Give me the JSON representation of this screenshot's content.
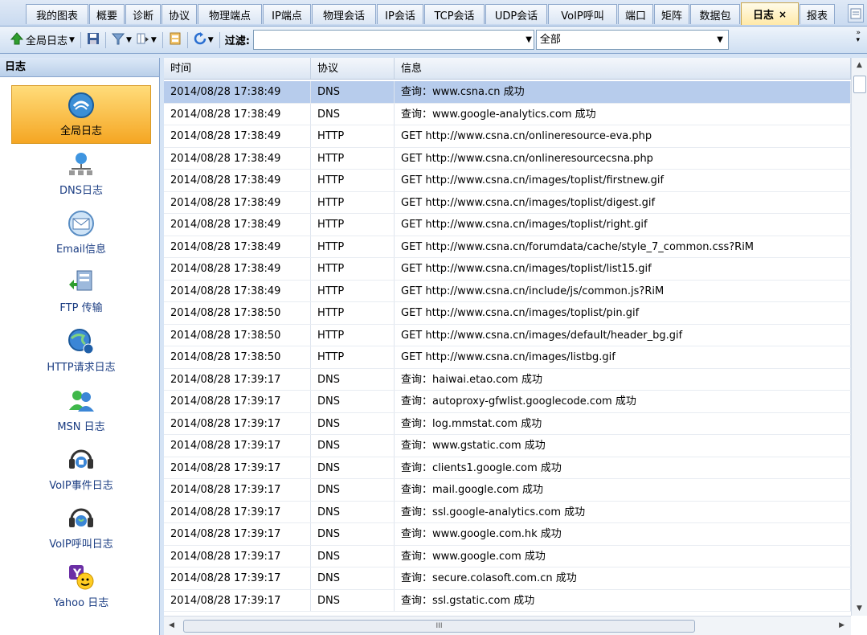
{
  "tabs": [
    {
      "label": "我的图表"
    },
    {
      "label": "概要"
    },
    {
      "label": "诊断"
    },
    {
      "label": "协议"
    },
    {
      "label": "物理端点"
    },
    {
      "label": "IP端点"
    },
    {
      "label": "物理会话"
    },
    {
      "label": "IP会话"
    },
    {
      "label": "TCP会话"
    },
    {
      "label": "UDP会话"
    },
    {
      "label": "VoIP呼叫"
    },
    {
      "label": "端口"
    },
    {
      "label": "矩阵"
    },
    {
      "label": "数据包"
    },
    {
      "label": "日志",
      "close": "×"
    },
    {
      "label": "报表"
    }
  ],
  "toolbar": {
    "global_log": "全局日志",
    "filter_label": "过滤:",
    "filter_value": "",
    "scope_value": "全部"
  },
  "sidebar": {
    "title": "日志",
    "items": [
      {
        "label": "全局日志",
        "icon": "global-log-icon"
      },
      {
        "label": "DNS日志",
        "icon": "dns-network-icon"
      },
      {
        "label": "Email信息",
        "icon": "email-icon"
      },
      {
        "label": "FTP 传输",
        "icon": "ftp-transfer-icon"
      },
      {
        "label": "HTTP请求日志",
        "icon": "http-globe-icon"
      },
      {
        "label": "MSN 日志",
        "icon": "msn-users-icon"
      },
      {
        "label": "VoIP事件日志",
        "icon": "voip-event-headset-icon"
      },
      {
        "label": "VoIP呼叫日志",
        "icon": "voip-call-headset-icon"
      },
      {
        "label": "Yahoo 日志",
        "icon": "yahoo-messenger-icon"
      }
    ]
  },
  "grid": {
    "headers": [
      "时间",
      "协议",
      "信息"
    ],
    "rows": [
      [
        "2014/08/28 17:38:49",
        "DNS",
        "查询：www.csna.cn 成功"
      ],
      [
        "2014/08/28 17:38:49",
        "DNS",
        "查询：www.google-analytics.com 成功"
      ],
      [
        "2014/08/28 17:38:49",
        "HTTP",
        "GET http://www.csna.cn/onlineresource-eva.php"
      ],
      [
        "2014/08/28 17:38:49",
        "HTTP",
        "GET http://www.csna.cn/onlineresourcecsna.php"
      ],
      [
        "2014/08/28 17:38:49",
        "HTTP",
        "GET http://www.csna.cn/images/toplist/firstnew.gif"
      ],
      [
        "2014/08/28 17:38:49",
        "HTTP",
        "GET http://www.csna.cn/images/toplist/digest.gif"
      ],
      [
        "2014/08/28 17:38:49",
        "HTTP",
        "GET http://www.csna.cn/images/toplist/right.gif"
      ],
      [
        "2014/08/28 17:38:49",
        "HTTP",
        "GET http://www.csna.cn/forumdata/cache/style_7_common.css?RiM"
      ],
      [
        "2014/08/28 17:38:49",
        "HTTP",
        "GET http://www.csna.cn/images/toplist/list15.gif"
      ],
      [
        "2014/08/28 17:38:49",
        "HTTP",
        "GET http://www.csna.cn/include/js/common.js?RiM"
      ],
      [
        "2014/08/28 17:38:50",
        "HTTP",
        "GET http://www.csna.cn/images/toplist/pin.gif"
      ],
      [
        "2014/08/28 17:38:50",
        "HTTP",
        "GET http://www.csna.cn/images/default/header_bg.gif"
      ],
      [
        "2014/08/28 17:38:50",
        "HTTP",
        "GET http://www.csna.cn/images/listbg.gif"
      ],
      [
        "2014/08/28 17:39:17",
        "DNS",
        "查询：haiwai.etao.com 成功"
      ],
      [
        "2014/08/28 17:39:17",
        "DNS",
        "查询：autoproxy-gfwlist.googlecode.com 成功"
      ],
      [
        "2014/08/28 17:39:17",
        "DNS",
        "查询：log.mmstat.com 成功"
      ],
      [
        "2014/08/28 17:39:17",
        "DNS",
        "查询：www.gstatic.com 成功"
      ],
      [
        "2014/08/28 17:39:17",
        "DNS",
        "查询：clients1.google.com 成功"
      ],
      [
        "2014/08/28 17:39:17",
        "DNS",
        "查询：mail.google.com 成功"
      ],
      [
        "2014/08/28 17:39:17",
        "DNS",
        "查询：ssl.google-analytics.com 成功"
      ],
      [
        "2014/08/28 17:39:17",
        "DNS",
        "查询：www.google.com.hk 成功"
      ],
      [
        "2014/08/28 17:39:17",
        "DNS",
        "查询：www.google.com 成功"
      ],
      [
        "2014/08/28 17:39:17",
        "DNS",
        "查询：secure.colasoft.com.cn 成功"
      ],
      [
        "2014/08/28 17:39:17",
        "DNS",
        "查询：ssl.gstatic.com 成功"
      ]
    ]
  },
  "scroll_marker": "III"
}
